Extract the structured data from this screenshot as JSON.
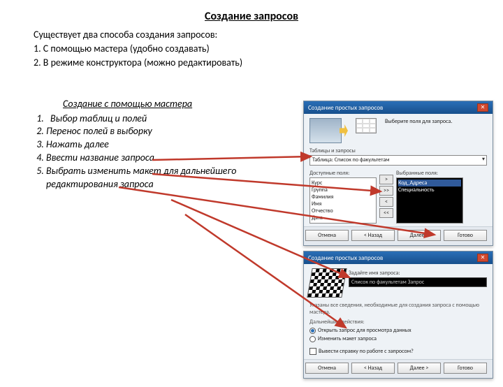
{
  "title": "Создание запросов",
  "intro": {
    "lead": "Существует два способа создания запросов:",
    "one": "1.   С помощью мастера (удобно создавать)",
    "two": "2.   В режиме конструктора (можно редактировать)"
  },
  "subhead": "Создание  с помощью мастера",
  "steps": [
    "Выбор таблиц и полей",
    "Перенос полей в выборку",
    "Нажать далее",
    "Ввести название запроса",
    "Выбрать изменить макет для дальнейшего редактирования запроса"
  ],
  "dialog1": {
    "title": "Создание простых запросов",
    "hint": "Выберите поля для запроса.",
    "tables_label": "Таблицы и запросы",
    "tables_value": "Таблица: Список по факультетам",
    "avail_label": "Доступные поля:",
    "sel_label": "Выбранные поля:",
    "avail_items": [
      "Курс",
      "Группа",
      "Фамилия",
      "Имя",
      "Отчество",
      "Дата"
    ],
    "sel_items": [
      "Код_Адреса",
      "Специальность"
    ],
    "move_r": ">",
    "move_rr": ">>",
    "move_l": "<",
    "move_ll": "<<",
    "btn_cancel": "Отмена",
    "btn_back": "< Назад",
    "btn_next": "Далее >",
    "btn_finish": "Готово"
  },
  "dialog2": {
    "title": "Создание простых запросов",
    "name_label": "Задайте имя запроса:",
    "name_value": "Список по факультетам Запрос",
    "hint1": "Указаны все сведения, необходимые для создания запроса с помощью мастера.",
    "hint2": "Дальнейшие действия:",
    "radio_open": "Открыть запрос для просмотра данных",
    "radio_edit": "Изменить макет запроса",
    "chk_help": "Вывести справку по работе с запросом?",
    "btn_cancel": "Отмена",
    "btn_back": "< Назад",
    "btn_next": "Далее >",
    "btn_finish": "Готово"
  }
}
